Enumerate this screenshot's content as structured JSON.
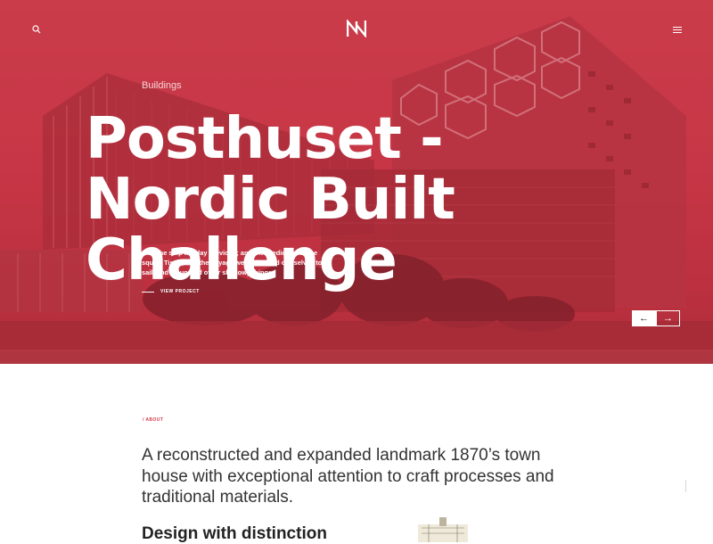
{
  "header": {
    "logo_text": "NN"
  },
  "hero": {
    "category": "Buildings",
    "title": "Posthuset - Nordic Built Challenge",
    "description": "I left the ship the day previous; and the prediction of the squaw Tistig; and the voyage we had bound our selves to sail; and a hundred other shadowy things.",
    "cta_label": "VIEW PROJECT",
    "prev_icon": "arrow-left-icon",
    "next_icon": "arrow-right-icon"
  },
  "about": {
    "label": "/ ABOUT",
    "text": "A reconstructed and expanded landmark 1870’s town house with exceptional attention to craft processes and traditional materials.",
    "subheading": "Design with distinction"
  },
  "colors": {
    "accent": "#c73644",
    "about_label": "#d33b49"
  }
}
